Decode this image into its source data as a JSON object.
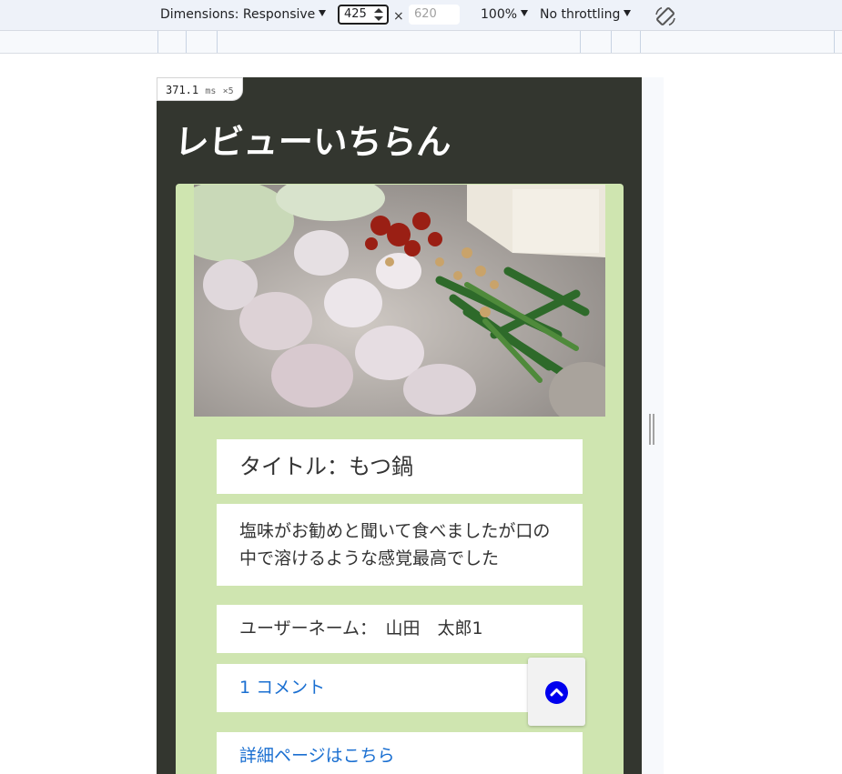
{
  "devtools": {
    "dimensions_label": "Dimensions: Responsive",
    "width_value": "425",
    "times_sign": "×",
    "height_placeholder": "620",
    "zoom_label": "100%",
    "throttling_label": "No throttling",
    "rotate_icon": "rotate-icon"
  },
  "perf_badge": {
    "time": "371.1",
    "unit": "ms",
    "multiplier": "×5"
  },
  "page": {
    "site_title": "レビューいちらん",
    "background_color": "#33362f",
    "card_color": "#cfe5b0",
    "review": {
      "title": "タイトル：もつ鍋",
      "description": "塩味がお勧めと聞いて食べましたが口の中で溶けるような感覚最高でした",
      "username": "ユーザーネーム：　山田　太郎1",
      "comments_link": "1 コメント",
      "detail_link": "詳細ページはこちら"
    },
    "scroll_top_icon": "chevron-up-icon",
    "link_color": "#1a6fd1"
  }
}
